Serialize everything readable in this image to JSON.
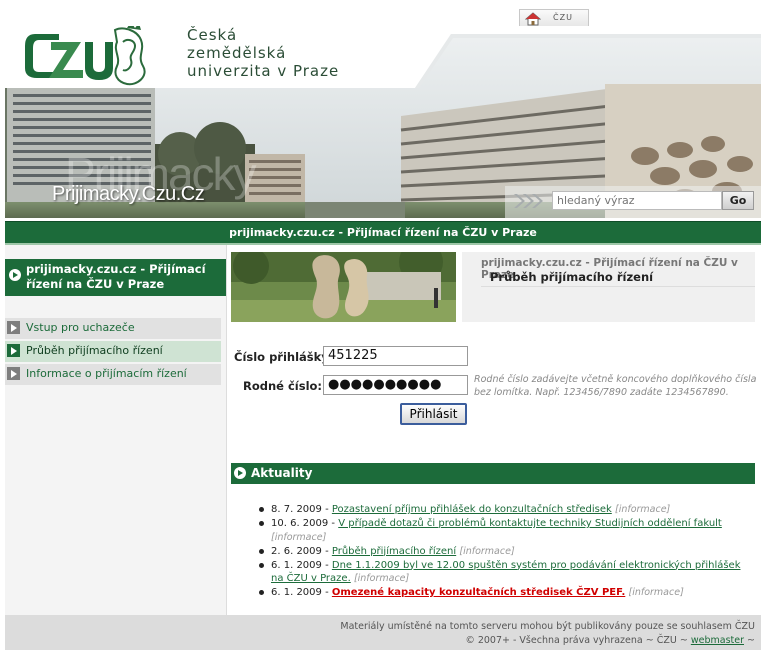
{
  "home_tab": {
    "label": "ČZU"
  },
  "university": {
    "line1": "Česká",
    "line2": "zemědělská",
    "line3": "univerzita v Praze"
  },
  "banner": {
    "site_title": "Prijimacky.Czu.Cz",
    "ghost_title": "Prijimacky"
  },
  "search": {
    "placeholder": "hledaný výraz",
    "button": "Go"
  },
  "title_bar": "prijimacky.czu.cz - Přijímací řízení na ČZU v Praze",
  "sidebar": {
    "heading": "prijimacky.czu.cz - Přijímací řízení na ČZU v Praze",
    "items": [
      {
        "label": "Vstup pro uchazeče"
      },
      {
        "label": "Průběh přijímacího řízení"
      },
      {
        "label": "Informace o přijímacím řízení"
      }
    ]
  },
  "breadcrumb": {
    "path": "prijimacky.czu.cz - Přijímací řízení na ČZU v Praze",
    "title": "Průběh přijímacího řízení"
  },
  "form": {
    "app_label": "Číslo přihlášky:",
    "app_value": "451225",
    "birth_label": "Rodné číslo:",
    "birth_value": "●●●●●●●●●●",
    "hint": "Rodné číslo zadávejte včetně koncového doplňkového čísla bez lomítka. Např. 123456/7890 zadáte 1234567890.",
    "submit": "Přihlásit"
  },
  "news": {
    "heading": "Aktuality",
    "items": [
      {
        "date": "8. 7. 2009 -",
        "text": "Pozastavení příjmu přihlášek do konzultačních středisek",
        "tag": "[informace]"
      },
      {
        "date": "10. 6. 2009 -",
        "text": "V případě dotazů či problémů kontaktujte techniky Studijních oddělení fakult",
        "tag": "[informace]"
      },
      {
        "date": "2. 6. 2009 -",
        "text": "Průběh přijímacího řízení",
        "tag": "[informace]"
      },
      {
        "date": "6. 1. 2009 -",
        "text": "Dne 1.1.2009 byl ve 12.00 spuštěn systém pro podávání elektronických přihlášek na ČZU v Praze.",
        "tag": "[informace]"
      },
      {
        "date": "6. 1. 2009 -",
        "text": "Omezené kapacity konzultačních středisek ČZV PEF.",
        "tag": "[informace]"
      }
    ]
  },
  "footer": {
    "line1": "Materiály umístěné na tomto serveru mohou být publikovány pouze se souhlasem ČZU",
    "line2_prefix": "© 2007+ - Všechna práva vyhrazena ~ ČZU ~",
    "webmaster": "webmaster",
    "line2_suffix": "~"
  },
  "colors": {
    "brand_green": "#1c6b3a",
    "footer_gray": "#dcdcdc",
    "nav_gray": "#e1e1e1"
  },
  "icons": [
    "home-icon",
    "university-logo",
    "search-arrows-icon",
    "bullet-arrow-icon",
    "nav-arrow-icon"
  ]
}
